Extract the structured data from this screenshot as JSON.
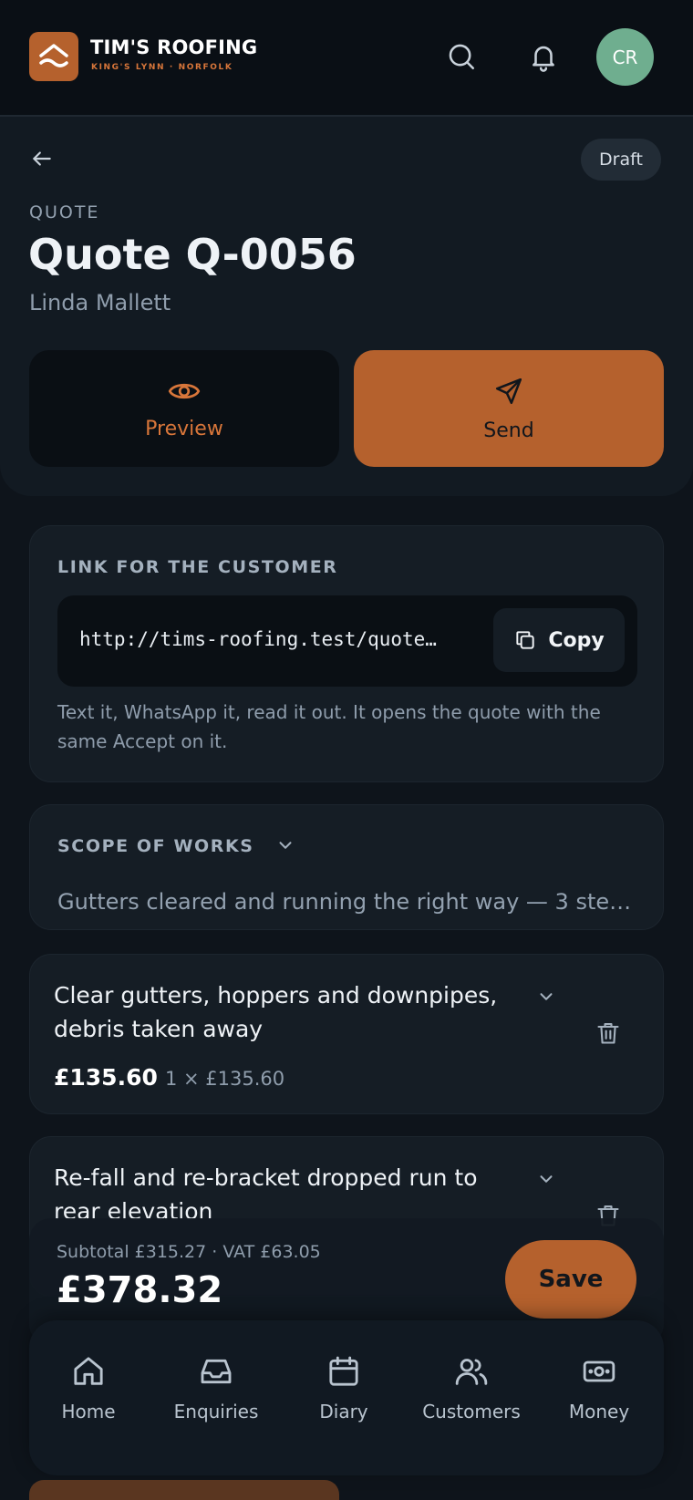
{
  "header": {
    "brand_name": "TIM'S ROOFING",
    "brand_location": "KING'S LYNN · NORFOLK",
    "avatar_initials": "CR",
    "colors": {
      "accent": "#b5612d",
      "avatar": "#6fae8f",
      "background": "#0e141b"
    }
  },
  "quote": {
    "status": "Draft",
    "eyebrow": "QUOTE",
    "title": "Quote Q-0056",
    "customer": "Linda Mallett",
    "preview_label": "Preview",
    "send_label": "Send"
  },
  "link_card": {
    "label": "LINK FOR THE CUSTOMER",
    "url": "http://tims-roofing.test/quote…",
    "copy_label": "Copy",
    "help": "Text it, WhatsApp it, read it out. It opens the quote with the same Accept on it."
  },
  "scope": {
    "label": "SCOPE OF WORKS",
    "summary": "Gutters cleared and running the right way — 3 ste…"
  },
  "line_items": [
    {
      "title": "Clear gutters, hoppers and downpipes, debris taken away",
      "price": "£135.60",
      "qty": "1 × £135.60"
    },
    {
      "title": "Re-fall and re-bracket dropped run to rear elevation"
    }
  ],
  "totals": {
    "breakdown": "Subtotal £315.27 · VAT £63.05",
    "total": "£378.32",
    "save_label": "Save"
  },
  "nav": [
    {
      "label": "Home",
      "icon": "home-icon"
    },
    {
      "label": "Enquiries",
      "icon": "inbox-icon"
    },
    {
      "label": "Diary",
      "icon": "calendar-icon"
    },
    {
      "label": "Customers",
      "icon": "users-icon"
    },
    {
      "label": "Money",
      "icon": "money-icon"
    }
  ]
}
